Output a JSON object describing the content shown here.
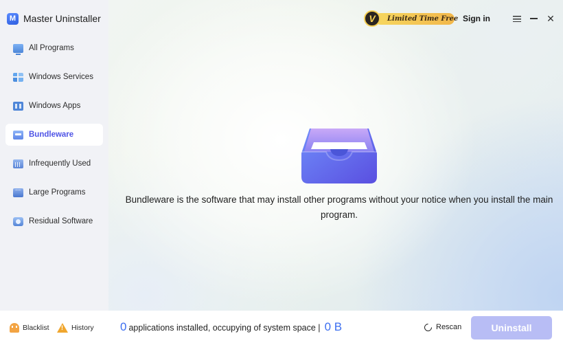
{
  "app": {
    "title": "Master Uninstaller",
    "logo_letter": "M"
  },
  "sidebar": {
    "items": [
      {
        "label": "All Programs",
        "icon": "monitor-icon",
        "active": false
      },
      {
        "label": "Windows Services",
        "icon": "windows-services-icon",
        "active": false
      },
      {
        "label": "Windows Apps",
        "icon": "windows-apps-icon",
        "active": false
      },
      {
        "label": "Bundleware",
        "icon": "bundleware-icon",
        "active": true
      },
      {
        "label": "Infrequently Used",
        "icon": "infrequently-used-icon",
        "active": false
      },
      {
        "label": "Large Programs",
        "icon": "large-programs-icon",
        "active": false
      },
      {
        "label": "Residual Software",
        "icon": "residual-software-icon",
        "active": false
      }
    ]
  },
  "header": {
    "promo_badge": "V",
    "promo_label": "Limited Time Free",
    "signin_label": "Sign in",
    "close_glyph": "✕"
  },
  "main": {
    "message": "Bundleware is the software that may install other programs without your notice when you install the main program."
  },
  "footer": {
    "blacklist_label": "Blacklist",
    "history_label": "History",
    "app_count": "0",
    "status_text": "applications installed, occupying of system space |",
    "space_value": "0 B",
    "rescan_label": "Rescan",
    "uninstall_label": "Uninstall"
  },
  "colors": {
    "accent": "#4f54e6",
    "button_disabled": "#b8bdf5",
    "count_blue": "#3d6ff0",
    "promo_gold": "#f2c04f"
  }
}
